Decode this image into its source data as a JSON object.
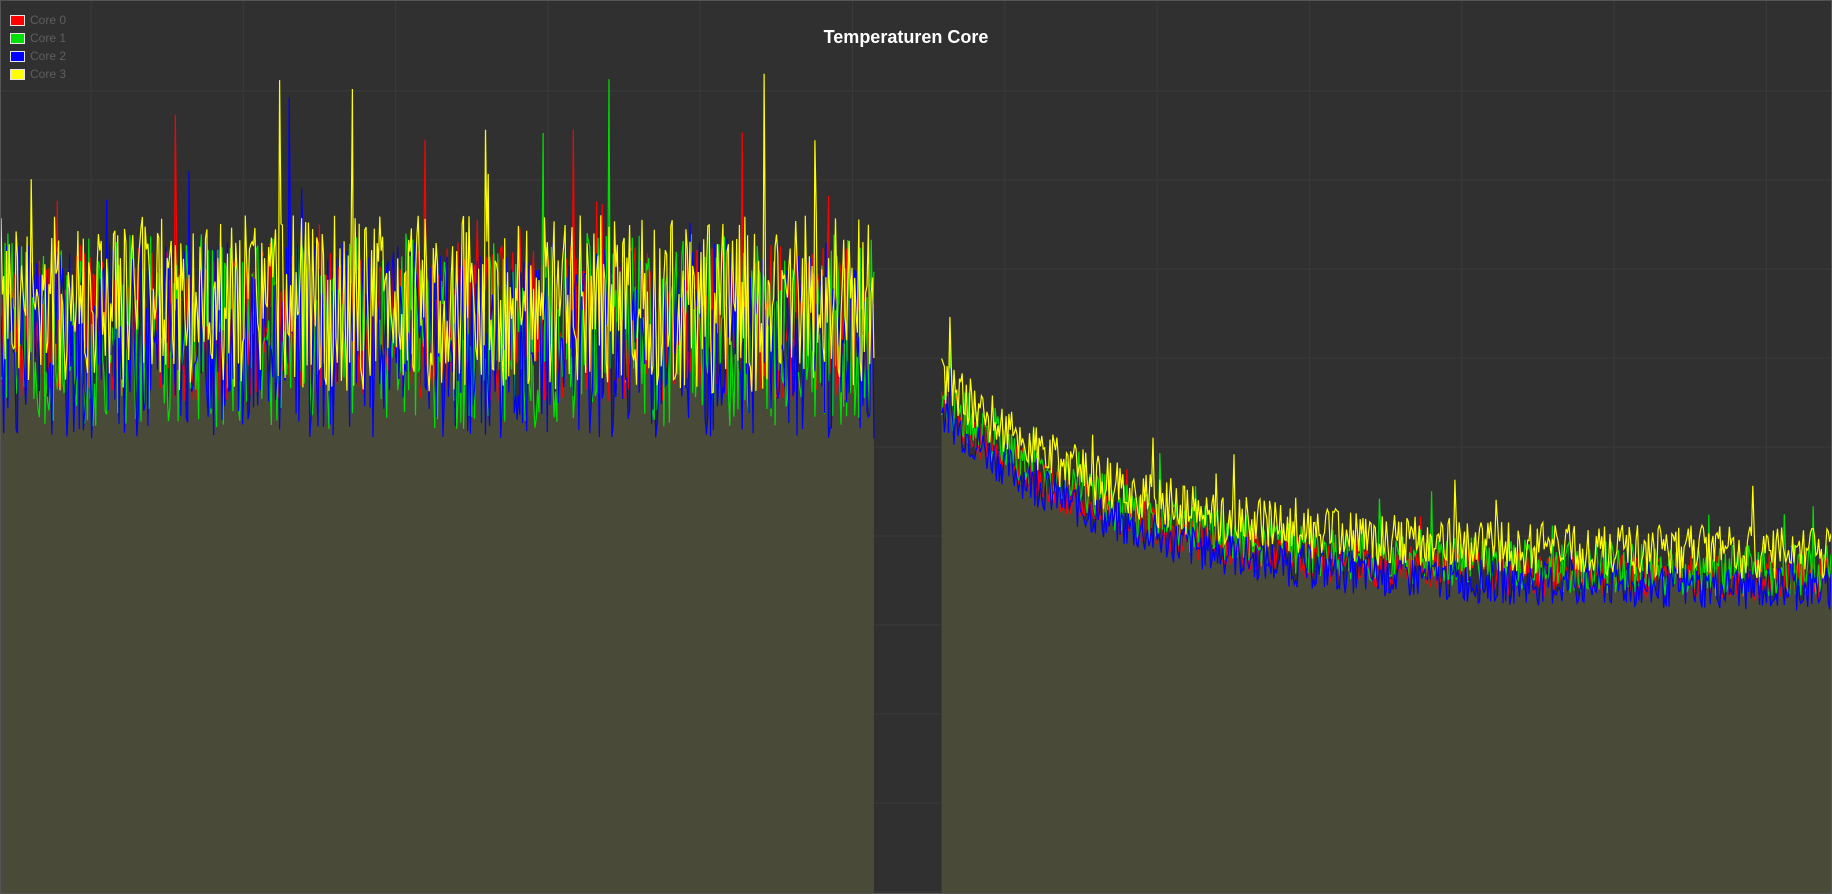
{
  "chart_data": {
    "type": "line",
    "title": "Temperaturen Core",
    "xlabel": "",
    "ylabel": "",
    "grid": true,
    "legend_position": "top-left",
    "fill_color": "#4a4a38",
    "x": {
      "min": 0,
      "max": 1000,
      "gap": [
        477,
        514
      ]
    },
    "ylim": [
      0,
      100
    ],
    "series": [
      {
        "name": "Core 0",
        "color": "#ff0000",
        "segments": [
          {
            "x0": 0,
            "x1": 477,
            "base": 64,
            "amp": 9,
            "seed": 11
          },
          {
            "x0": 514,
            "x1": 1000,
            "start": 55,
            "end": 35,
            "amp": 2.5,
            "seed": 12
          }
        ]
      },
      {
        "name": "Core 1",
        "color": "#00e000",
        "segments": [
          {
            "x0": 0,
            "x1": 477,
            "base": 63,
            "amp": 11,
            "seed": 21
          },
          {
            "x0": 514,
            "x1": 1000,
            "start": 56,
            "end": 36,
            "amp": 3,
            "seed": 22
          }
        ]
      },
      {
        "name": "Core 2",
        "color": "#0000ff",
        "segments": [
          {
            "x0": 0,
            "x1": 477,
            "base": 62,
            "amp": 11,
            "seed": 31
          },
          {
            "x0": 514,
            "x1": 1000,
            "start": 54,
            "end": 34,
            "amp": 2.5,
            "seed": 32
          }
        ]
      },
      {
        "name": "Core 3",
        "color": "#ffff00",
        "segments": [
          {
            "x0": 0,
            "x1": 477,
            "base": 66,
            "amp": 10,
            "seed": 41
          },
          {
            "x0": 514,
            "x1": 1000,
            "start": 58,
            "end": 38,
            "amp": 3,
            "seed": 42
          }
        ]
      }
    ]
  }
}
